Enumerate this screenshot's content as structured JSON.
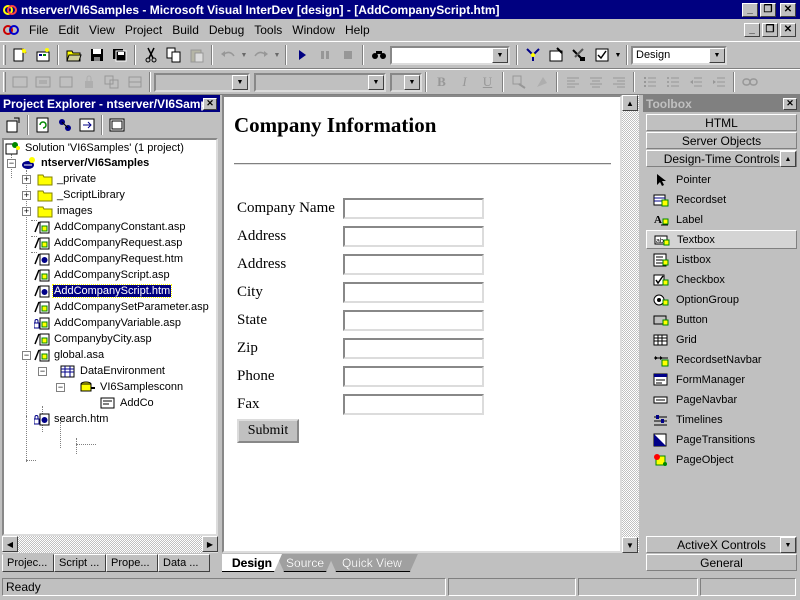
{
  "window": {
    "title": "ntserver/VI6Samples - Microsoft Visual InterDev [design] - [AddCompanyScript.htm]"
  },
  "menu": {
    "items": [
      {
        "label": "File",
        "key": "F"
      },
      {
        "label": "Edit",
        "key": "E"
      },
      {
        "label": "View",
        "key": "V"
      },
      {
        "label": "Project",
        "key": "P"
      },
      {
        "label": "Build",
        "key": "B"
      },
      {
        "label": "Debug",
        "key": "D"
      },
      {
        "label": "Tools",
        "key": "T"
      },
      {
        "label": "Window",
        "key": "W"
      },
      {
        "label": "Help",
        "key": "H"
      }
    ]
  },
  "toolbar": {
    "mode_value": "Design",
    "find_value": ""
  },
  "project_explorer": {
    "title": "Project Explorer - ntserver/VI6Samples",
    "tree": [
      {
        "label": "Solution 'VI6Samples' (1 project)",
        "icon": "solution-icon"
      },
      {
        "label": "ntserver/VI6Samples",
        "icon": "project-icon",
        "bold": true
      },
      {
        "label": "_private",
        "icon": "folder-icon"
      },
      {
        "label": "_ScriptLibrary",
        "icon": "folder-icon"
      },
      {
        "label": "images",
        "icon": "folder-icon"
      },
      {
        "label": "AddCompanyConstant.asp",
        "icon": "asp-file-icon"
      },
      {
        "label": "AddCompanyRequest.asp",
        "icon": "asp-file-icon"
      },
      {
        "label": "AddCompanyRequest.htm",
        "icon": "htm-file-icon"
      },
      {
        "label": "AddCompanyScript.asp",
        "icon": "asp-file-icon"
      },
      {
        "label": "AddCompanyScript.htm",
        "icon": "htm-file-icon",
        "selected": true
      },
      {
        "label": "AddCompanySetParameter.asp",
        "icon": "asp-file-icon"
      },
      {
        "label": "AddCompanyVariable.asp",
        "icon": "asp-file-locked-icon"
      },
      {
        "label": "CompanybyCity.asp",
        "icon": "asp-file-icon"
      },
      {
        "label": "global.asa",
        "icon": "asa-file-icon"
      },
      {
        "label": "DataEnvironment",
        "icon": "data-environment-icon"
      },
      {
        "label": "VI6Samplesconn",
        "icon": "connection-icon"
      },
      {
        "label": "AddCo",
        "icon": "command-icon"
      },
      {
        "label": "search.htm",
        "icon": "htm-file-locked-icon"
      }
    ],
    "tabs": [
      "Projec...",
      "Script ...",
      "Prope...",
      "Data ..."
    ]
  },
  "document": {
    "heading": "Company Information",
    "fields": [
      "Company Name",
      "Address",
      "Address",
      "City",
      "State",
      "Zip",
      "Phone",
      "Fax"
    ],
    "submit_label": "Submit"
  },
  "view_tabs": [
    "Design",
    "Source",
    "Quick View"
  ],
  "toolbox": {
    "title": "Toolbox",
    "sections_top": [
      "HTML",
      "Server Objects",
      "Design-Time Controls"
    ],
    "items": [
      {
        "label": "Pointer",
        "icon": "pointer-icon"
      },
      {
        "label": "Recordset",
        "icon": "recordset-icon"
      },
      {
        "label": "Label",
        "icon": "label-icon"
      },
      {
        "label": "Textbox",
        "icon": "textbox-icon",
        "selected": true
      },
      {
        "label": "Listbox",
        "icon": "listbox-icon"
      },
      {
        "label": "Checkbox",
        "icon": "checkbox-icon"
      },
      {
        "label": "OptionGroup",
        "icon": "optiongroup-icon"
      },
      {
        "label": "Button",
        "icon": "button-icon"
      },
      {
        "label": "Grid",
        "icon": "grid-icon"
      },
      {
        "label": "RecordsetNavbar",
        "icon": "recordset-navbar-icon"
      },
      {
        "label": "FormManager",
        "icon": "formmanager-icon"
      },
      {
        "label": "PageNavbar",
        "icon": "pagenavbar-icon"
      },
      {
        "label": "Timelines",
        "icon": "timelines-icon"
      },
      {
        "label": "PageTransitions",
        "icon": "pagetransitions-icon"
      },
      {
        "label": "PageObject",
        "icon": "pageobject-icon"
      }
    ],
    "sections_bottom": [
      "ActiveX Controls",
      "General"
    ]
  },
  "status": {
    "text": "Ready"
  }
}
